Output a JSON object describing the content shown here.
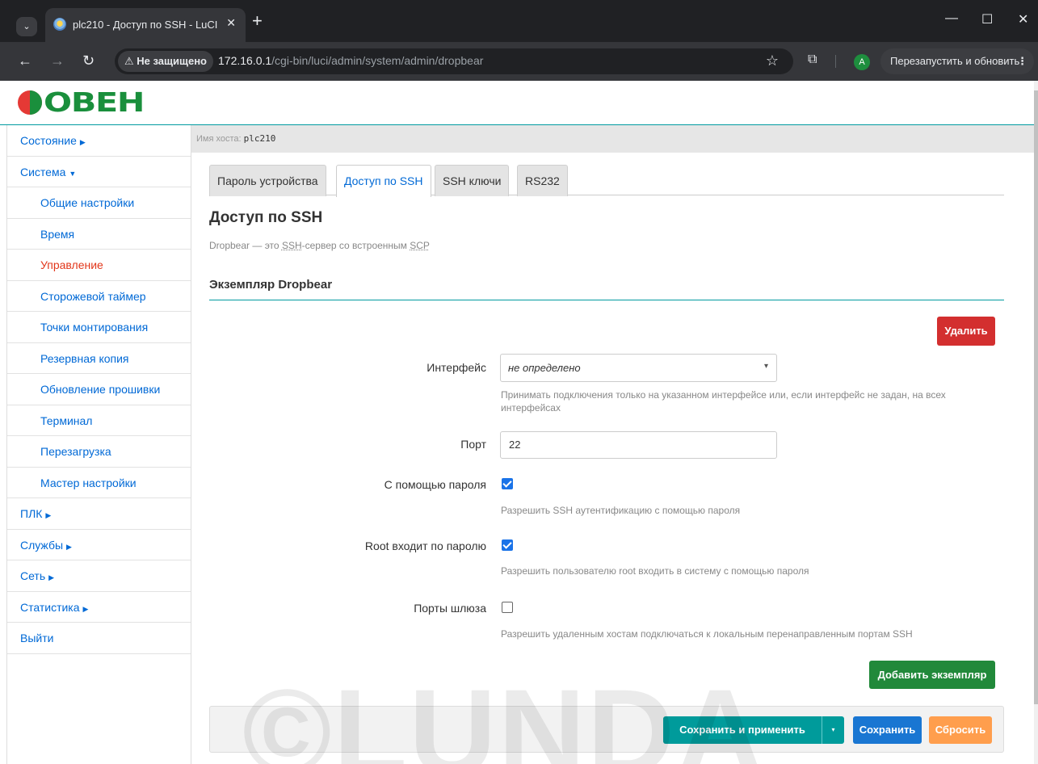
{
  "browser": {
    "tab_title": "plc210 - Доступ по SSH - LuCI",
    "security_label": "Не защищено",
    "url_host": "172.16.0.1",
    "url_path": "/cgi-bin/luci/admin/system/admin/dropbear",
    "avatar_letter": "A",
    "relaunch_label": "Перезапустить и обновить"
  },
  "header": {
    "logo_text": "ОВЕН"
  },
  "sidebar": {
    "items": [
      {
        "label": "Состояние",
        "caret": "▶"
      },
      {
        "label": "Система",
        "caret": "▼"
      },
      {
        "label": "Общие настройки"
      },
      {
        "label": "Время"
      },
      {
        "label": "Управление"
      },
      {
        "label": "Сторожевой таймер"
      },
      {
        "label": "Точки монтирования"
      },
      {
        "label": "Резервная копия"
      },
      {
        "label": "Обновление прошивки"
      },
      {
        "label": "Терминал"
      },
      {
        "label": "Перезагрузка"
      },
      {
        "label": "Мастер настройки"
      },
      {
        "label": "ПЛК",
        "caret": "▶"
      },
      {
        "label": "Службы",
        "caret": "▶"
      },
      {
        "label": "Сеть",
        "caret": "▶"
      },
      {
        "label": "Статистика",
        "caret": "▶"
      },
      {
        "label": "Выйти"
      }
    ]
  },
  "hostbar": {
    "label": "Имя хоста:",
    "value": "plc210"
  },
  "tabs": [
    {
      "label": "Пароль устройства"
    },
    {
      "label": "Доступ по SSH"
    },
    {
      "label": "SSH ключи"
    },
    {
      "label": "RS232"
    }
  ],
  "section": {
    "title": "Доступ по SSH",
    "desc_prefix": "Dropbear — это ",
    "desc_abbr1": "SSH",
    "desc_middle": "-сервер со встроенным ",
    "desc_abbr2": "SCP",
    "subsection_title": "Экземпляр Dropbear"
  },
  "form": {
    "delete_label": "Удалить",
    "interface_label": "Интерфейс",
    "interface_value": "не определено",
    "interface_help": "Принимать подключения только на указанном интерфейсе или, если интерфейс не задан, на всех интерфейсах",
    "port_label": "Порт",
    "port_value": "22",
    "password_auth_label": "С помощью пароля",
    "password_auth_help": "Разрешить SSH аутентификацию с помощью пароля",
    "password_auth_checked": true,
    "root_password_label": "Root входит по паролю",
    "root_password_help": "Разрешить пользователю root входить в систему с помощью пароля",
    "root_password_checked": true,
    "gateway_ports_label": "Порты шлюза",
    "gateway_ports_help": "Разрешить удаленным хостам подключаться к локальным перенаправленным портам SSH",
    "gateway_ports_checked": false,
    "add_instance_label": "Добавить экземпляр"
  },
  "actions": {
    "save_apply_label": "Сохранить и применить",
    "dropdown_glyph": "▾",
    "save_label": "Сохранить",
    "reset_label": "Сбросить"
  },
  "watermark": {
    "text": "©LUNDA"
  },
  "colors": {
    "link": "#0069d6",
    "active_link": "#e2361a",
    "delete": "#d32f2f",
    "add": "#21893a",
    "save_apply": "#009b9b",
    "save": "#1976d2",
    "reset": "#ff9e4d",
    "accent_line": "#009aa0"
  }
}
